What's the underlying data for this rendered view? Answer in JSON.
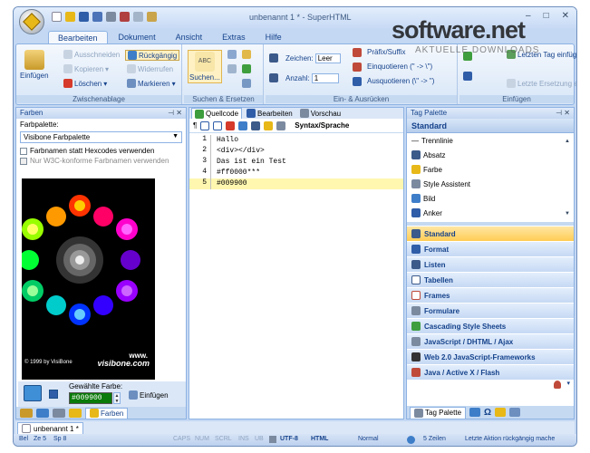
{
  "window": {
    "title": "unbenannt 1 * - SuperHTML",
    "controls": [
      "–",
      "□",
      "✕"
    ]
  },
  "watermark": {
    "main": "software.net",
    "sub": "AKTUELLE DOWNLOADS"
  },
  "ribbon": {
    "tabs": [
      "Bearbeiten",
      "Dokument",
      "Ansicht",
      "Extras",
      "Hilfe"
    ],
    "active_tab": "Bearbeiten",
    "clipboard": {
      "label": "Zwischenablage",
      "insert": "Einfügen",
      "cut": "Ausschneiden",
      "copy": "Kopieren",
      "delete": "Löschen",
      "undo": "Rückgängig",
      "redo": "Widerrufen",
      "mark": "Markieren"
    },
    "search": {
      "label": "Suchen & Ersetzen",
      "search": "Suchen..."
    },
    "indent": {
      "label": "Ein- & Ausrücken",
      "chars_label": "Zeichen:",
      "chars_value": "Leer",
      "count_label": "Anzahl:",
      "count_value": "1",
      "prefix": "Präfix/Suffix",
      "enquote": "Einquotieren (\" -> \\\")",
      "dequote": "Ausquotieren (\\\" -> \")"
    },
    "insert": {
      "label": "Einfügen",
      "last_tag": "Letzten Tag einfügen",
      "last_repeat": "Letzte Ersetzung einfügen"
    }
  },
  "colors_panel": {
    "title": "Farben",
    "palette_label": "Farbpalette:",
    "palette_value": "Visibone Farbpalette",
    "opt1": "Farbnamen statt Hexcodes verwenden",
    "opt2": "Nur W3C-konforme Farbnamen verwenden",
    "copyright": "© 1999 by VisiBone",
    "www": "www.",
    "brand": "visibone.com",
    "chosen_label": "Gewählte Farbe:",
    "chosen_value": "#009900",
    "insert": "Einfügen",
    "tab_label": "Farben"
  },
  "editor": {
    "tabs": [
      "Quellcode",
      "Bearbeiten",
      "Vorschau"
    ],
    "syntax": "Syntax/Sprache",
    "lines": [
      {
        "n": "1",
        "text": "Hallo"
      },
      {
        "n": "2",
        "text": "<div></div>"
      },
      {
        "n": "3",
        "text": "Das ist ein Test"
      },
      {
        "n": "4",
        "text": "#ff0000***"
      },
      {
        "n": "5",
        "text": "#009900"
      }
    ]
  },
  "tag_palette": {
    "title": "Tag Palette",
    "section": "Standard",
    "items": [
      "Trennlinie",
      "Absatz",
      "Farbe",
      "Style Assistent",
      "Bild",
      "Anker"
    ],
    "categories": [
      "Standard",
      "Format",
      "Listen",
      "Tabellen",
      "Frames",
      "Formulare",
      "Cascading Style Sheets",
      "JavaScript / DHTML / Ajax",
      "Web 2.0 JavaScript-Frameworks",
      "Java / Active X / Flash"
    ],
    "active_category": "Standard",
    "tab_label": "Tag Palette"
  },
  "document_tab": "unbenannt 1 *",
  "status": {
    "line": "Bel",
    "row": "Ze 5",
    "col": "Sp 8",
    "caps": "CAPS",
    "num": "NUM",
    "scrl": "SCRL",
    "ins": "INS",
    "ub": "UB",
    "encoding": "UTF-8",
    "lang": "HTML",
    "mode": "Normal",
    "lines": "5 Zeilen",
    "last_action": "Letzte Aktion rückgängig mache"
  }
}
